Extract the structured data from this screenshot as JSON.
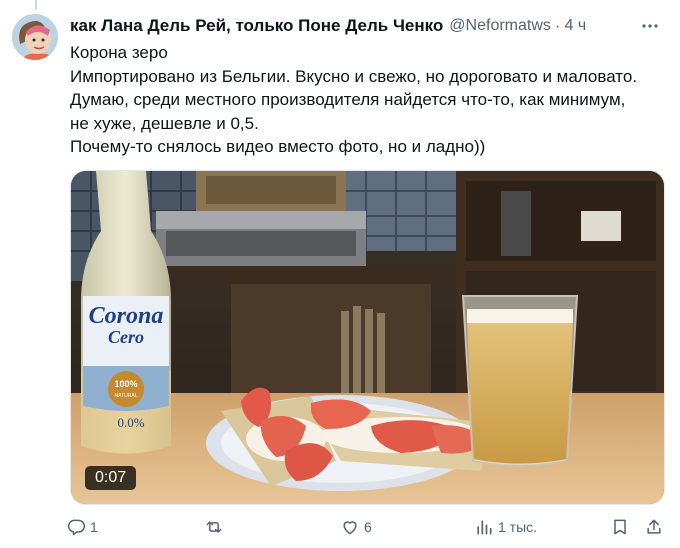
{
  "author": {
    "display_name": "как Лана Дель Рей, только Поне Дель Ченко",
    "handle": "@Neformatws",
    "dot": "·",
    "time": "4 ч"
  },
  "tweet": {
    "lines": [
      "Корона зеро",
      "Импортировано из Бельгии. Вкусно и свежо, но дороговато и маловато.",
      "Думаю, среди местного производителя найдется что-то, как минимум,",
      "не хуже, дешевле и 0,5.",
      "Почему-то снялось видео вместо фото, но и ладно))"
    ]
  },
  "media": {
    "duration": "0:07",
    "bottle_label": {
      "brand_line1": "Corona",
      "brand_line2": "Cero",
      "badge_line1": "100%",
      "badge_line2": "NATURAL",
      "abv": "0.0%"
    }
  },
  "actions": {
    "reply_count": "1",
    "retweet_count": "",
    "like_count": "6",
    "views_count": "1 тыс."
  },
  "icons": {
    "more": "more-icon",
    "reply": "reply-icon",
    "retweet": "retweet-icon",
    "like": "like-icon",
    "views": "views-icon",
    "bookmark": "bookmark-icon",
    "share": "share-icon"
  },
  "colors": {
    "text": "#0f1419",
    "secondary": "#536471"
  }
}
